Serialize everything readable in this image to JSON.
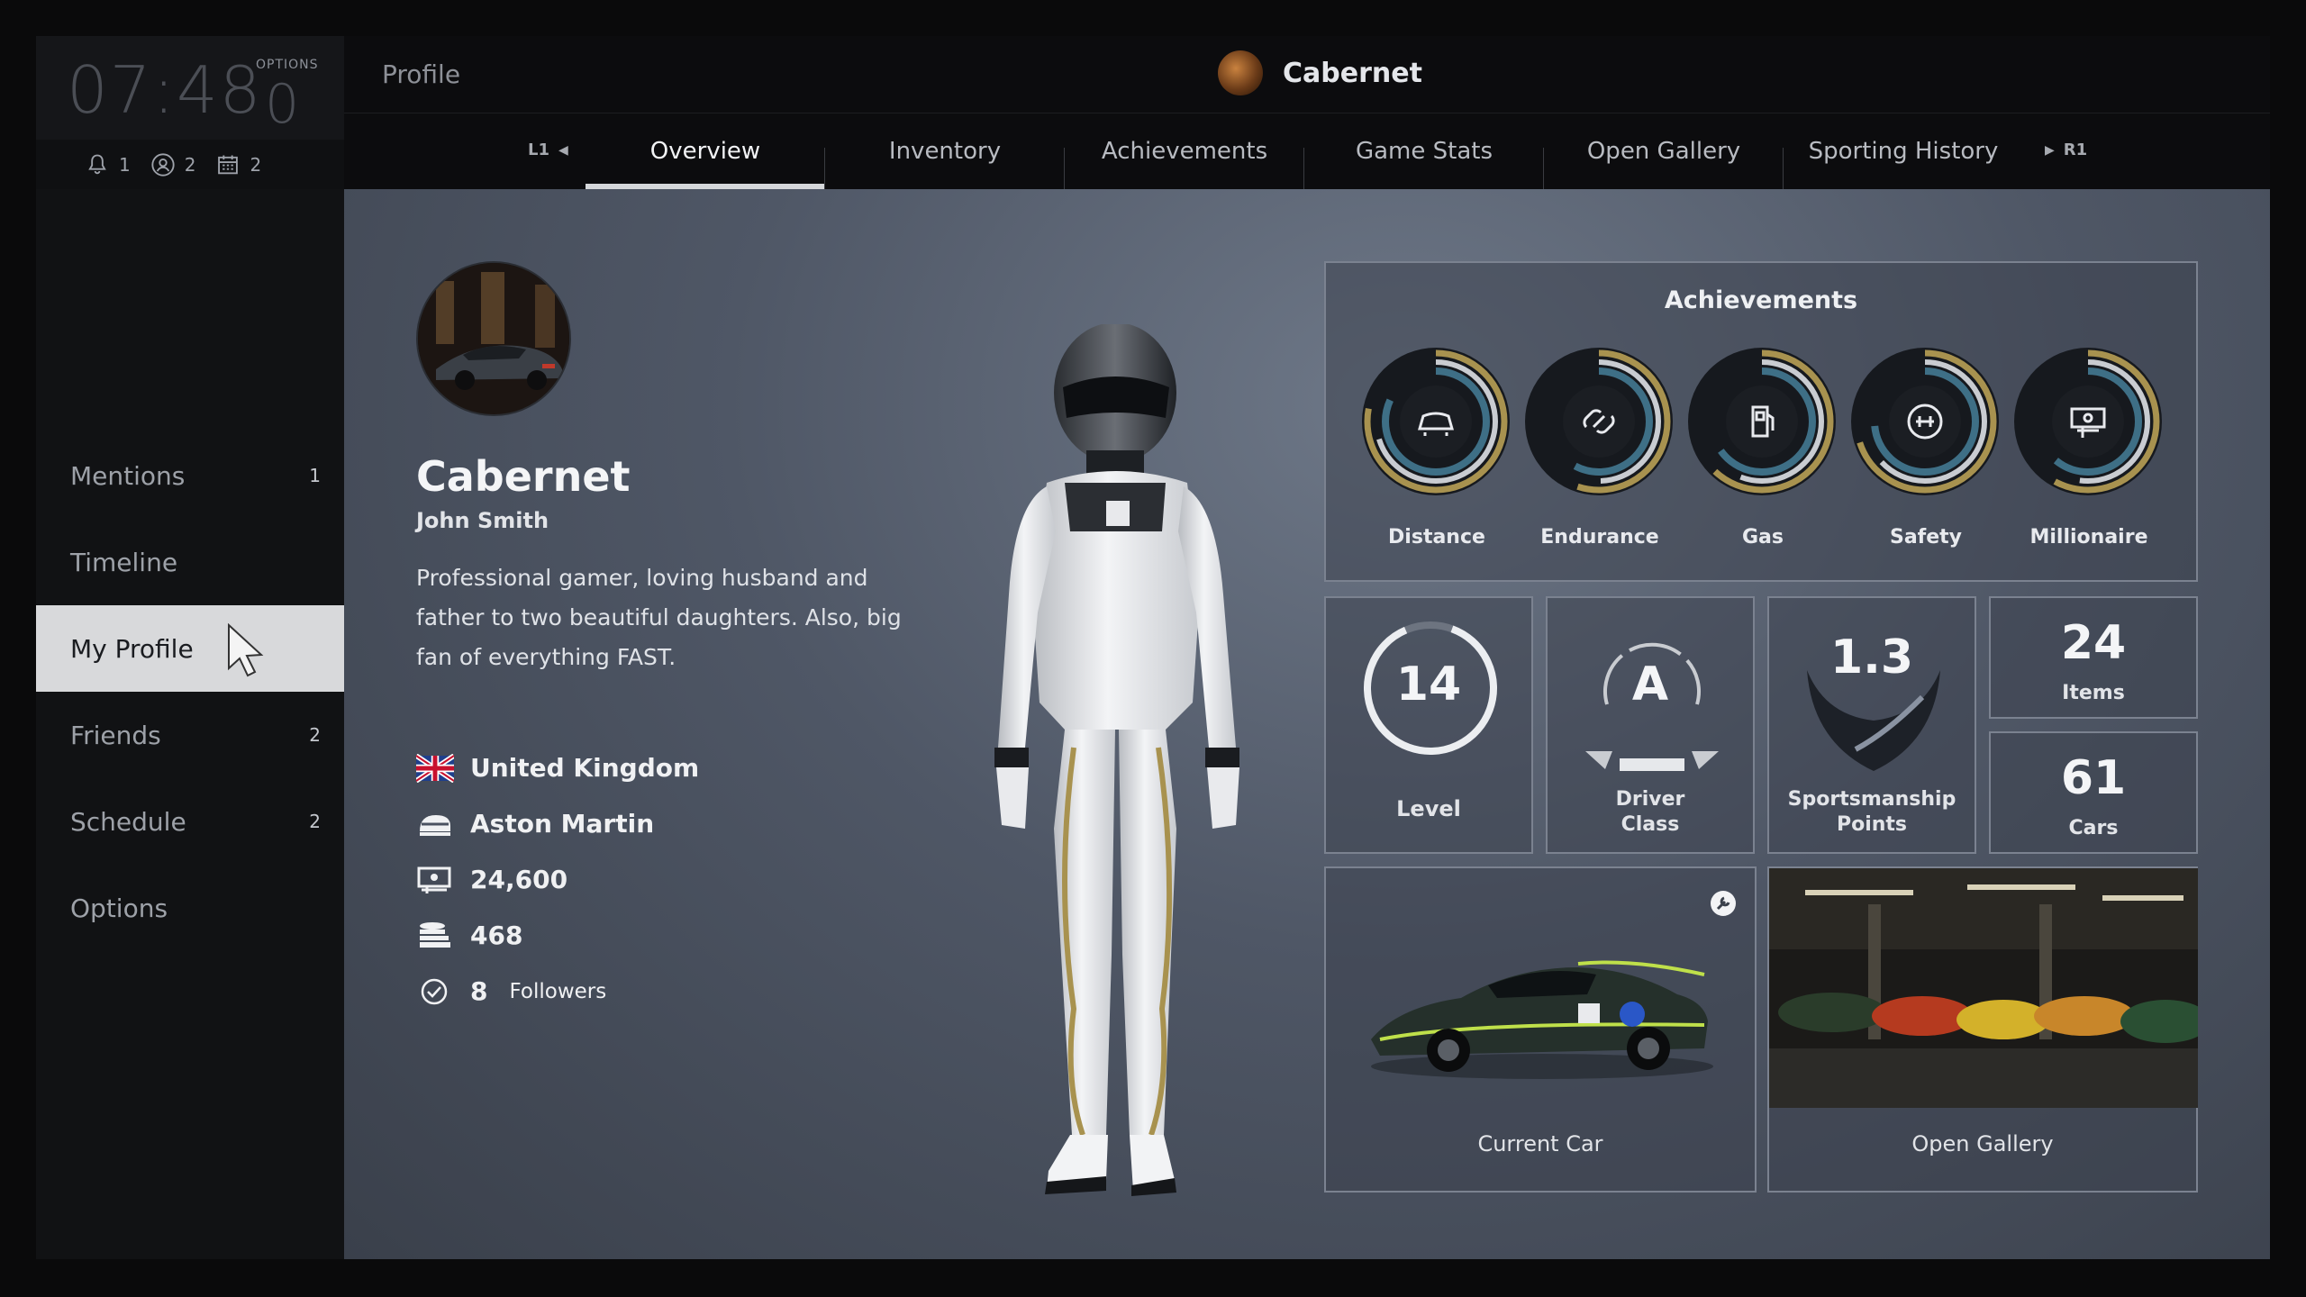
{
  "system": {
    "clock": "07:48",
    "options_label": "OPTIONS",
    "options_value": "0",
    "notifications": [
      {
        "icon": "bell-icon",
        "count": "1"
      },
      {
        "icon": "friend-request-icon",
        "count": "2"
      },
      {
        "icon": "calendar-icon",
        "count": "2"
      }
    ]
  },
  "sidebar": {
    "items": [
      {
        "label": "Mentions",
        "count": "1"
      },
      {
        "label": "Timeline",
        "count": ""
      },
      {
        "label": "My Profile",
        "count": ""
      },
      {
        "label": "Friends",
        "count": "2"
      },
      {
        "label": "Schedule",
        "count": "2"
      },
      {
        "label": "Options",
        "count": ""
      }
    ],
    "active": "My Profile"
  },
  "header": {
    "title": "Profile",
    "username": "Cabernet"
  },
  "tabs": {
    "left_shoulder": "L1",
    "right_shoulder": "R1",
    "items": [
      "Overview",
      "Inventory",
      "Achievements",
      "Game Stats",
      "Open Gallery",
      "Sporting History"
    ],
    "active": "Overview"
  },
  "profile": {
    "player_name": "Cabernet",
    "real_name": "John Smith",
    "bio": "Professional gamer, loving husband and father to two beautiful daughters. Also, big fan of everything FAST.",
    "country": "United Kingdom",
    "manufacturer": "Aston Martin",
    "credits": "24,600",
    "mileage_points": "468",
    "followers_count": "8",
    "followers_label": "Followers"
  },
  "achievements": {
    "title": "Achievements",
    "items": [
      {
        "label": "Distance",
        "icon": "car-icon",
        "progress": 0.78
      },
      {
        "label": "Endurance",
        "icon": "link-icon",
        "progress": 0.55
      },
      {
        "label": "Gas",
        "icon": "fuel-pump-icon",
        "progress": 0.62
      },
      {
        "label": "Safety",
        "icon": "safety-icon",
        "progress": 0.7
      },
      {
        "label": "Millionaire",
        "icon": "money-icon",
        "progress": 0.58
      }
    ]
  },
  "stats": {
    "level_value": "14",
    "level_label": "Level",
    "level_progress": 0.88,
    "driver_class_value": "A",
    "driver_class_label_1": "Driver",
    "driver_class_label_2": "Class",
    "sportsmanship_value": "1.3",
    "sportsmanship_label_1": "Sportsmanship",
    "sportsmanship_label_2": "Points",
    "items_value": "24",
    "items_label": "Items",
    "cars_value": "61",
    "cars_label": "Cars"
  },
  "tiles": {
    "current_car_label": "Current Car",
    "open_gallery_label": "Open Gallery"
  },
  "colors": {
    "accent_gold": "#a8924f",
    "ring_gray": "#c9ccd1",
    "ring_teal": "#3e6f86",
    "active_menu_bg": "#d8d9db"
  }
}
